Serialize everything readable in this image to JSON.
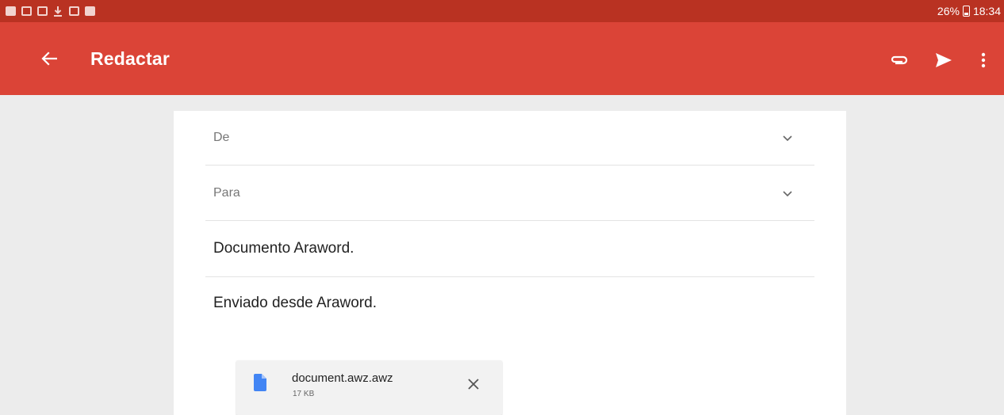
{
  "status_bar": {
    "notification_icons": [
      "facebook-icon",
      "gmail-icon",
      "image-icon",
      "download-icon",
      "copy-icon",
      "photos-icon"
    ],
    "battery": "26%",
    "time": "18:34"
  },
  "app_bar": {
    "title": "Redactar",
    "actions": [
      "attach-icon",
      "send-icon",
      "more-vert-icon"
    ],
    "color": "#db4437"
  },
  "compose": {
    "from_label": "De",
    "to_label": "Para",
    "subject": "Documento Araword.",
    "body": "Enviado desde Araword."
  },
  "attachment": {
    "file_name": "document.awz.awz",
    "file_size": "17 KB",
    "icon": "file-icon"
  }
}
